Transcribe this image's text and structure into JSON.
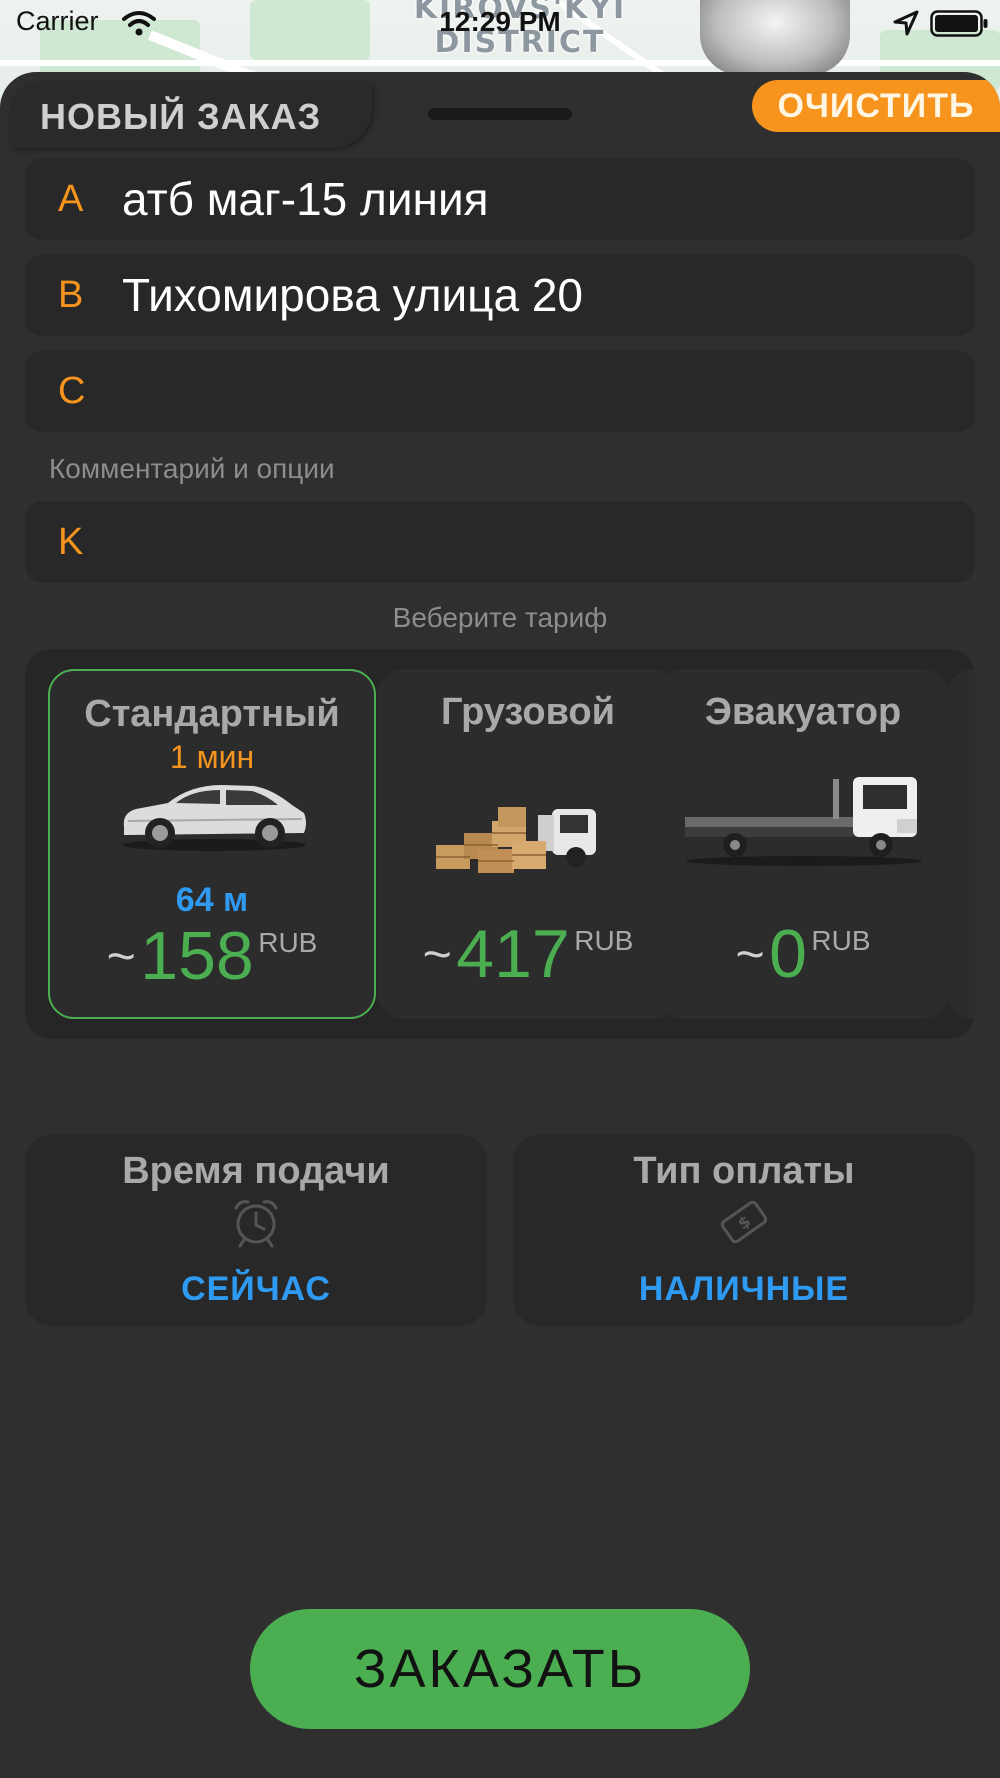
{
  "status_bar": {
    "carrier": "Carrier",
    "time": "12:29 PM"
  },
  "map": {
    "district_line1": "KIROVS'KYI",
    "district_line2": "DISTRICT"
  },
  "header": {
    "title": "НОВЫЙ ЗАКАЗ",
    "clear_label": "ОЧИСТИТЬ"
  },
  "route": {
    "points": [
      {
        "letter": "A",
        "value": "атб маг-15 линия"
      },
      {
        "letter": "B",
        "value": "Тихомирова улица 20"
      },
      {
        "letter": "C",
        "value": ""
      }
    ],
    "comment_label": "Комментарий и опции",
    "comment": {
      "letter": "K",
      "value": ""
    }
  },
  "tariffs": {
    "heading": "Веберите тариф",
    "items": [
      {
        "name": "Стандартный",
        "eta": "1 мин",
        "distance": "64 м",
        "tilde": "~",
        "price": "158",
        "currency": "RUB",
        "vehicle_icon": "car-icon",
        "selected": true
      },
      {
        "name": "Грузовой",
        "eta": "",
        "distance": "",
        "tilde": "~",
        "price": "417",
        "currency": "RUB",
        "vehicle_icon": "cargo-truck-icon",
        "selected": false
      },
      {
        "name": "Эвакуатор",
        "eta": "",
        "distance": "",
        "tilde": "~",
        "price": "0",
        "currency": "RUB",
        "vehicle_icon": "tow-truck-icon",
        "selected": false
      }
    ]
  },
  "options": {
    "pickup_time": {
      "title": "Время подачи",
      "value": "СЕЙЧАС",
      "icon": "alarm-clock-icon"
    },
    "payment": {
      "title": "Тип оплаты",
      "value": "НАЛИЧНЫЕ",
      "icon": "cash-icon"
    }
  },
  "order_button": {
    "label": "ЗАКАЗАТЬ"
  },
  "colors": {
    "accent_orange": "#f7941d",
    "price_green": "#4bae50",
    "link_blue": "#2e9af2",
    "background": "#2f2f30"
  }
}
